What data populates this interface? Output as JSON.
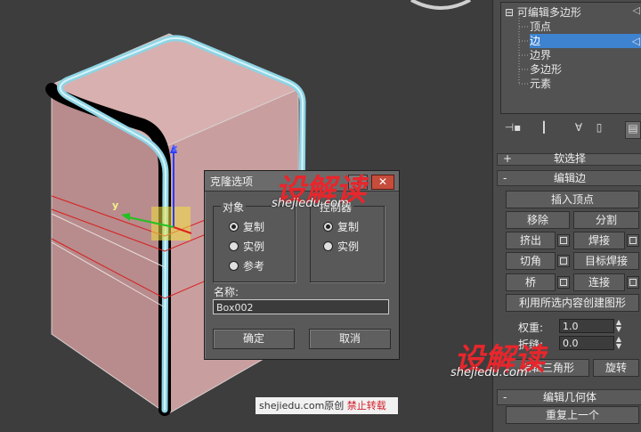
{
  "modifier_stack": {
    "items": [
      {
        "label": "可编辑多边形",
        "expander": "⊟"
      },
      {
        "label": "顶点"
      },
      {
        "label": "边",
        "selected": true
      },
      {
        "label": "边界"
      },
      {
        "label": "多边形"
      },
      {
        "label": "元素"
      }
    ]
  },
  "rollouts": {
    "soft_selection": "软选择",
    "edit_edges": "编辑边",
    "edit_geometry": "编辑几何体"
  },
  "edit_edges": {
    "insert_vertex": "插入顶点",
    "remove": "移除",
    "split": "分割",
    "extrude": "挤出",
    "weld": "焊接",
    "chamfer": "切角",
    "target_weld": "目标焊接",
    "bridge": "桥",
    "connect": "连接",
    "create_shape": "利用所选内容创建图形",
    "weight_label": "权重:",
    "weight_value": "1.0",
    "crease_label": "折缝:",
    "crease_value": "0.0",
    "edit_tri": "编辑三角形",
    "turn": "旋转"
  },
  "edit_geometry": {
    "repeat_last": "重复上一个"
  },
  "clone_dialog": {
    "title": "克隆选项",
    "help": "?",
    "close": "✕",
    "object_group": "对象",
    "object_options": [
      "复制",
      "实例",
      "参考"
    ],
    "object_selected": "复制",
    "controller_group": "控制器",
    "controller_options": [
      "复制",
      "实例"
    ],
    "controller_selected": "复制",
    "name_label": "名称:",
    "name_value": "Box002",
    "ok": "确定",
    "cancel": "取消"
  },
  "viewport": {
    "axis_x": "x",
    "axis_y": "y",
    "axis_z": "z"
  },
  "watermarks": {
    "brand": "设解读",
    "url": "shejiedu.com",
    "credit_site": "shejiedu.com原创",
    "credit_warning": "禁止转载"
  },
  "colors": {
    "selection_blue": "#3e83cf",
    "box_face": "#c8a0a0",
    "edge_selected": "#9fd8e6",
    "watermark_red": "#e8262c"
  }
}
